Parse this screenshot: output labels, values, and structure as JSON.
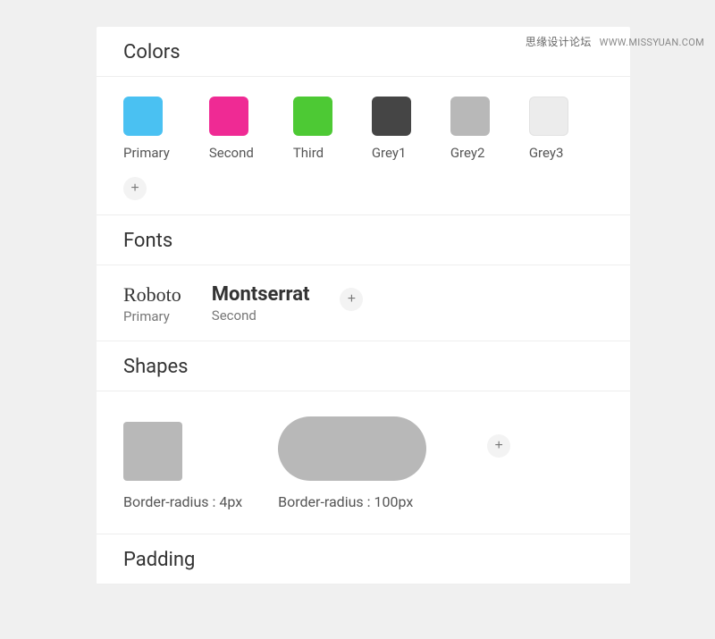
{
  "watermark": {
    "cn": "思缘设计论坛",
    "url": "WWW.MISSYUAN.COM"
  },
  "sections": {
    "colors": {
      "title": "Colors",
      "items": [
        {
          "label": "Primary",
          "hex": "#4ac1f2"
        },
        {
          "label": "Second",
          "hex": "#ef2a94"
        },
        {
          "label": "Third",
          "hex": "#4dc934"
        },
        {
          "label": "Grey1",
          "hex": "#454545"
        },
        {
          "label": "Grey2",
          "hex": "#b8b8b8"
        },
        {
          "label": "Grey3",
          "hex": "#ececec"
        }
      ],
      "add": "+"
    },
    "fonts": {
      "title": "Fonts",
      "items": [
        {
          "name": "Roboto",
          "label": "Primary"
        },
        {
          "name": "Montserrat",
          "label": "Second"
        }
      ],
      "add": "+"
    },
    "shapes": {
      "title": "Shapes",
      "items": [
        {
          "label": "Border-radius : 4px"
        },
        {
          "label": "Border-radius : 100px"
        }
      ],
      "add": "+"
    },
    "padding": {
      "title": "Padding"
    }
  }
}
